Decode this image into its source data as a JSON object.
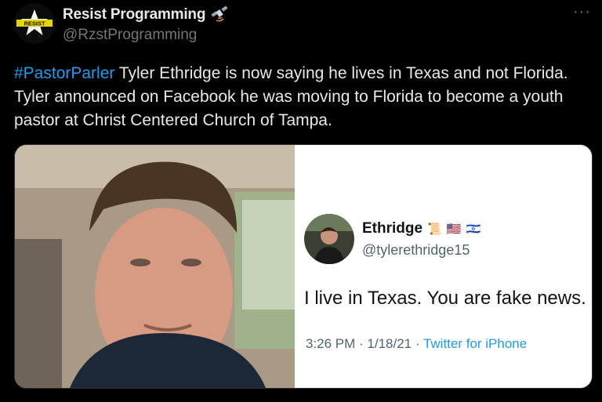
{
  "author": {
    "display_name": "Resist Programming",
    "handle": "@RzstProgramming",
    "avatar_text": "RESIST",
    "badge_icon": "satellite-icon"
  },
  "more_menu": "···",
  "tweet": {
    "hashtag": "#PastorParler",
    "text": " Tyler Ethridge is now saying he lives in Texas and not Florida. Tyler announced on Facebook he was moving to Florida to become a youth pastor at Christ Centered Church of Tampa."
  },
  "quoted": {
    "name": "Ethridge",
    "emojis": [
      "📜",
      "🇺🇸",
      "🇮🇱"
    ],
    "handle": "@tylerethridge15",
    "text": "I live in Texas. You are fake news.",
    "time": "3:26 PM · 1/18/21 · ",
    "source": "Twitter for iPhone"
  },
  "colors": {
    "accent": "#1d9bf0",
    "background": "#000000",
    "secondary_text": "#71767b"
  }
}
